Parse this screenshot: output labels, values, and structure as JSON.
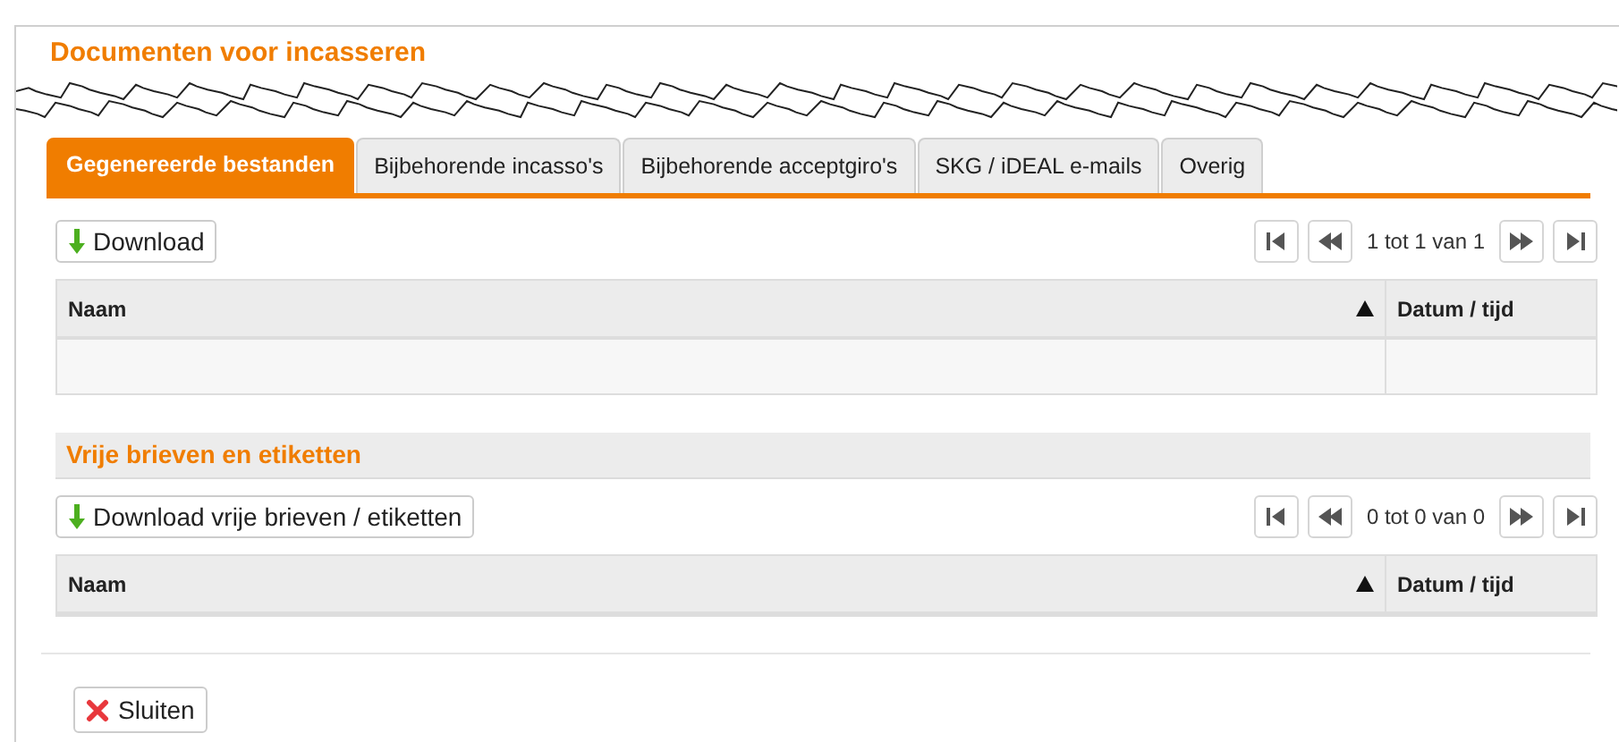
{
  "title": "Documenten voor incasseren",
  "tabs": [
    {
      "label": "Gegenereerde bestanden",
      "selected": true
    },
    {
      "label": "Bijbehorende incasso's",
      "selected": false
    },
    {
      "label": "Bijbehorende acceptgiro's",
      "selected": false
    },
    {
      "label": "SKG / iDEAL e-mails",
      "selected": false
    },
    {
      "label": "Overig",
      "selected": false
    }
  ],
  "sections": [
    {
      "button": "Download",
      "pager": "1 tot 1 van 1",
      "columns": [
        {
          "label": "Naam",
          "sorted": true
        },
        {
          "label": "Datum / tijd",
          "sorted": false
        }
      ],
      "empty_row": true
    },
    {
      "heading": "Vrije brieven en etiketten",
      "button": "Download vrije brieven / etiketten",
      "pager": "0 tot 0 van 0",
      "columns": [
        {
          "label": "Naam",
          "sorted": true
        },
        {
          "label": "Datum / tijd",
          "sorted": false
        }
      ],
      "empty_row": false
    }
  ],
  "close_button": "Sluiten"
}
